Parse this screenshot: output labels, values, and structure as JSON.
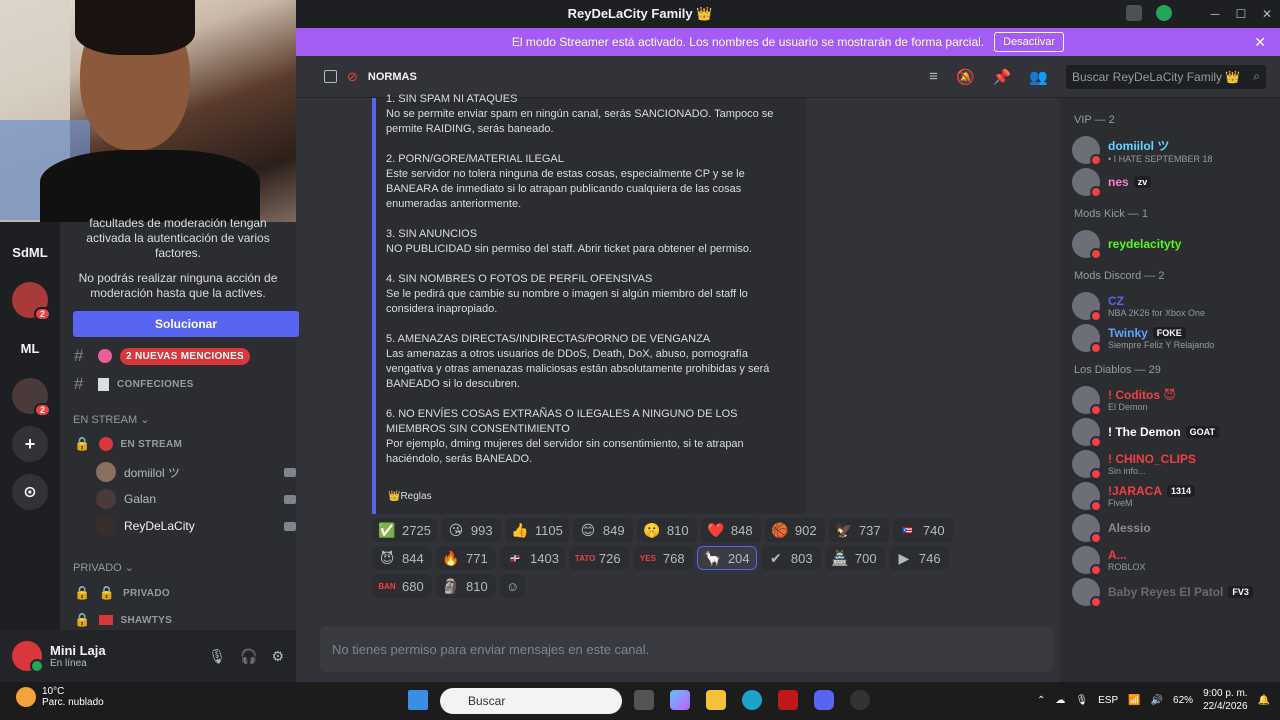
{
  "window": {
    "title": "ReyDeLaCity Family 👑"
  },
  "streamer_banner": {
    "text": "El modo Streamer está activado. Los nombres de usuario se mostrarán de forma parcial.",
    "button": "Desactivar"
  },
  "guilds": [
    {
      "label": "SdML"
    },
    {
      "label": "",
      "badge": "2"
    },
    {
      "label": "ML"
    },
    {
      "label": "",
      "badge": "2"
    },
    {
      "label": "+"
    },
    {
      "label": "⊙"
    }
  ],
  "sidebar": {
    "notice_1": "facultades de moderación tengan activada la autenticación de varios factores.",
    "notice_2": "No podrás realizar ninguna acción de moderación hasta que la actives.",
    "fix_button": "Solucionar",
    "mentions_badge": "2 NUEVAS MENCIONES",
    "channel_confesiones": "CONFECIONES",
    "category_stream": "EN STREAM",
    "channel_stream": "EN STREAM",
    "stream_members": [
      "domiilol ツ",
      "Galan",
      "ReyDeLaCity"
    ],
    "category_private": "PRIVADO",
    "channel_private": "PRIVADO",
    "channel_shawtys": "SHAWTYS"
  },
  "user": {
    "name": "Mini Laja",
    "status": "En línea"
  },
  "channel": {
    "name": "NORMAS",
    "search_placeholder": "Buscar ReyDeLaCity Family 👑"
  },
  "rules": [
    {
      "title": "1. SIN SPAM NI ATAQUES",
      "body": "No se permite enviar spam en ningún canal, serás SANCIONADO. Tampoco se permite RAIDING, serás baneado."
    },
    {
      "title": "2. PORN/GORE/MATERIAL ILEGAL",
      "body": "Este servidor no tolera ninguna de estas cosas, especialmente CP y se le BANEARA de inmediato si lo atrapan publicando cualquiera de las cosas enumeradas anteriormente."
    },
    {
      "title": "3. SIN ANUNCIOS",
      "body": "NO PUBLICIDAD sin permiso del staff. Abrir ticket para obtener el permiso."
    },
    {
      "title": "4. SIN NOMBRES O FOTOS DE PERFIL OFENSIVAS",
      "body": "Se le pedirá que cambie su nombre o imagen si algún miembro del staff lo considera inapropiado."
    },
    {
      "title": "5. AMENAZAS DIRECTAS/INDIRECTAS/PORNO DE VENGANZA",
      "body": "Las amenazas a otros usuarios de DDoS, Death, DoX, abuso, pornografía vengativa y otras amenazas maliciosas están absolutamente prohibidas y será BANEADO si lo descubren."
    },
    {
      "title": "6. NO ENVÍES COSAS EXTRAÑAS O ILEGALES A NINGUNO DE LOS MIEMBROS SIN CONSENTIMIENTO",
      "body": "Por ejemplo, dming mujeres del servidor sin consentimiento, si te atrapan haciéndolo, serás BANEADO."
    }
  ],
  "embed_footer": "👑Reglas",
  "reactions": [
    {
      "emoji": "✅",
      "count": "2725"
    },
    {
      "emoji": "😘",
      "count": "993"
    },
    {
      "emoji": "👍",
      "count": "1105"
    },
    {
      "emoji": "😊",
      "count": "849"
    },
    {
      "emoji": "🤫",
      "count": "810"
    },
    {
      "emoji": "❤️",
      "count": "848"
    },
    {
      "emoji": "🏀",
      "count": "902"
    },
    {
      "emoji": "🦅",
      "count": "737"
    },
    {
      "emoji": "🇵🇷",
      "count": "740"
    },
    {
      "emoji": "😈",
      "count": "844"
    },
    {
      "emoji": "🔥",
      "count": "771"
    },
    {
      "emoji": "🇩🇴",
      "count": "1403"
    },
    {
      "emoji": "TATO",
      "count": "726"
    },
    {
      "emoji": "YES",
      "count": "768"
    },
    {
      "emoji": "🦙",
      "count": "204",
      "active": true
    },
    {
      "emoji": "✔",
      "count": "803"
    },
    {
      "emoji": "🏯",
      "count": "700"
    },
    {
      "emoji": "▶",
      "count": "746"
    },
    {
      "emoji": "BAN",
      "count": "680"
    },
    {
      "emoji": "🗿",
      "count": "810"
    }
  ],
  "input_placeholder": "No tienes permiso para enviar mensajes en este canal.",
  "members": {
    "vip_header": "VIP — 2",
    "vip": [
      {
        "name": "domiilol ツ",
        "status": "• I HATE SEPTEMBER 18",
        "color": "#64d8ff"
      },
      {
        "name": "nes",
        "tag": "zv",
        "color": "#ff7bd5"
      }
    ],
    "kick_header": "Mods Kick — 1",
    "kick": [
      {
        "name": "reydelacityty",
        "color": "#53fc18"
      }
    ],
    "discord_header": "Mods Discord — 2",
    "discord": [
      {
        "name": "CZ",
        "status": "NBA 2K26 for Xbox One",
        "color": "#5865f2"
      },
      {
        "name": "Twinky",
        "tag": "FOKE",
        "status": "Siempre Feliz Y Relajando",
        "color": "#5aa3ff"
      }
    ],
    "diablos_header": "Los Diablos — 29",
    "diablos": [
      {
        "name": "! Coditos 😈",
        "status": "El Demon",
        "color": "#f23f43"
      },
      {
        "name": "! The Demon",
        "tag": "GOAT",
        "color": "#ffffff"
      },
      {
        "name": "! CHINO_CLIPS",
        "status": "Sin info...",
        "color": "#f23f43"
      },
      {
        "name": "!JARACA",
        "tag": "1314",
        "status": "FiveM",
        "color": "#f23f43"
      },
      {
        "name": "Alessio",
        "color": "#8a8a8a"
      },
      {
        "name": "A...",
        "status": "ROBLOX",
        "color": "#f23f43"
      },
      {
        "name": "Baby Reyes El Patol",
        "tag": "FV3",
        "color": "#6a6a6a"
      }
    ]
  },
  "taskbar": {
    "weather_temp": "10°C",
    "weather_desc": "Parc. nublado",
    "weather_badge": "1",
    "search": "Buscar",
    "lang": "ESP",
    "battery": "62%",
    "time": "9:00 p. m.",
    "date": "22/4/2026"
  }
}
